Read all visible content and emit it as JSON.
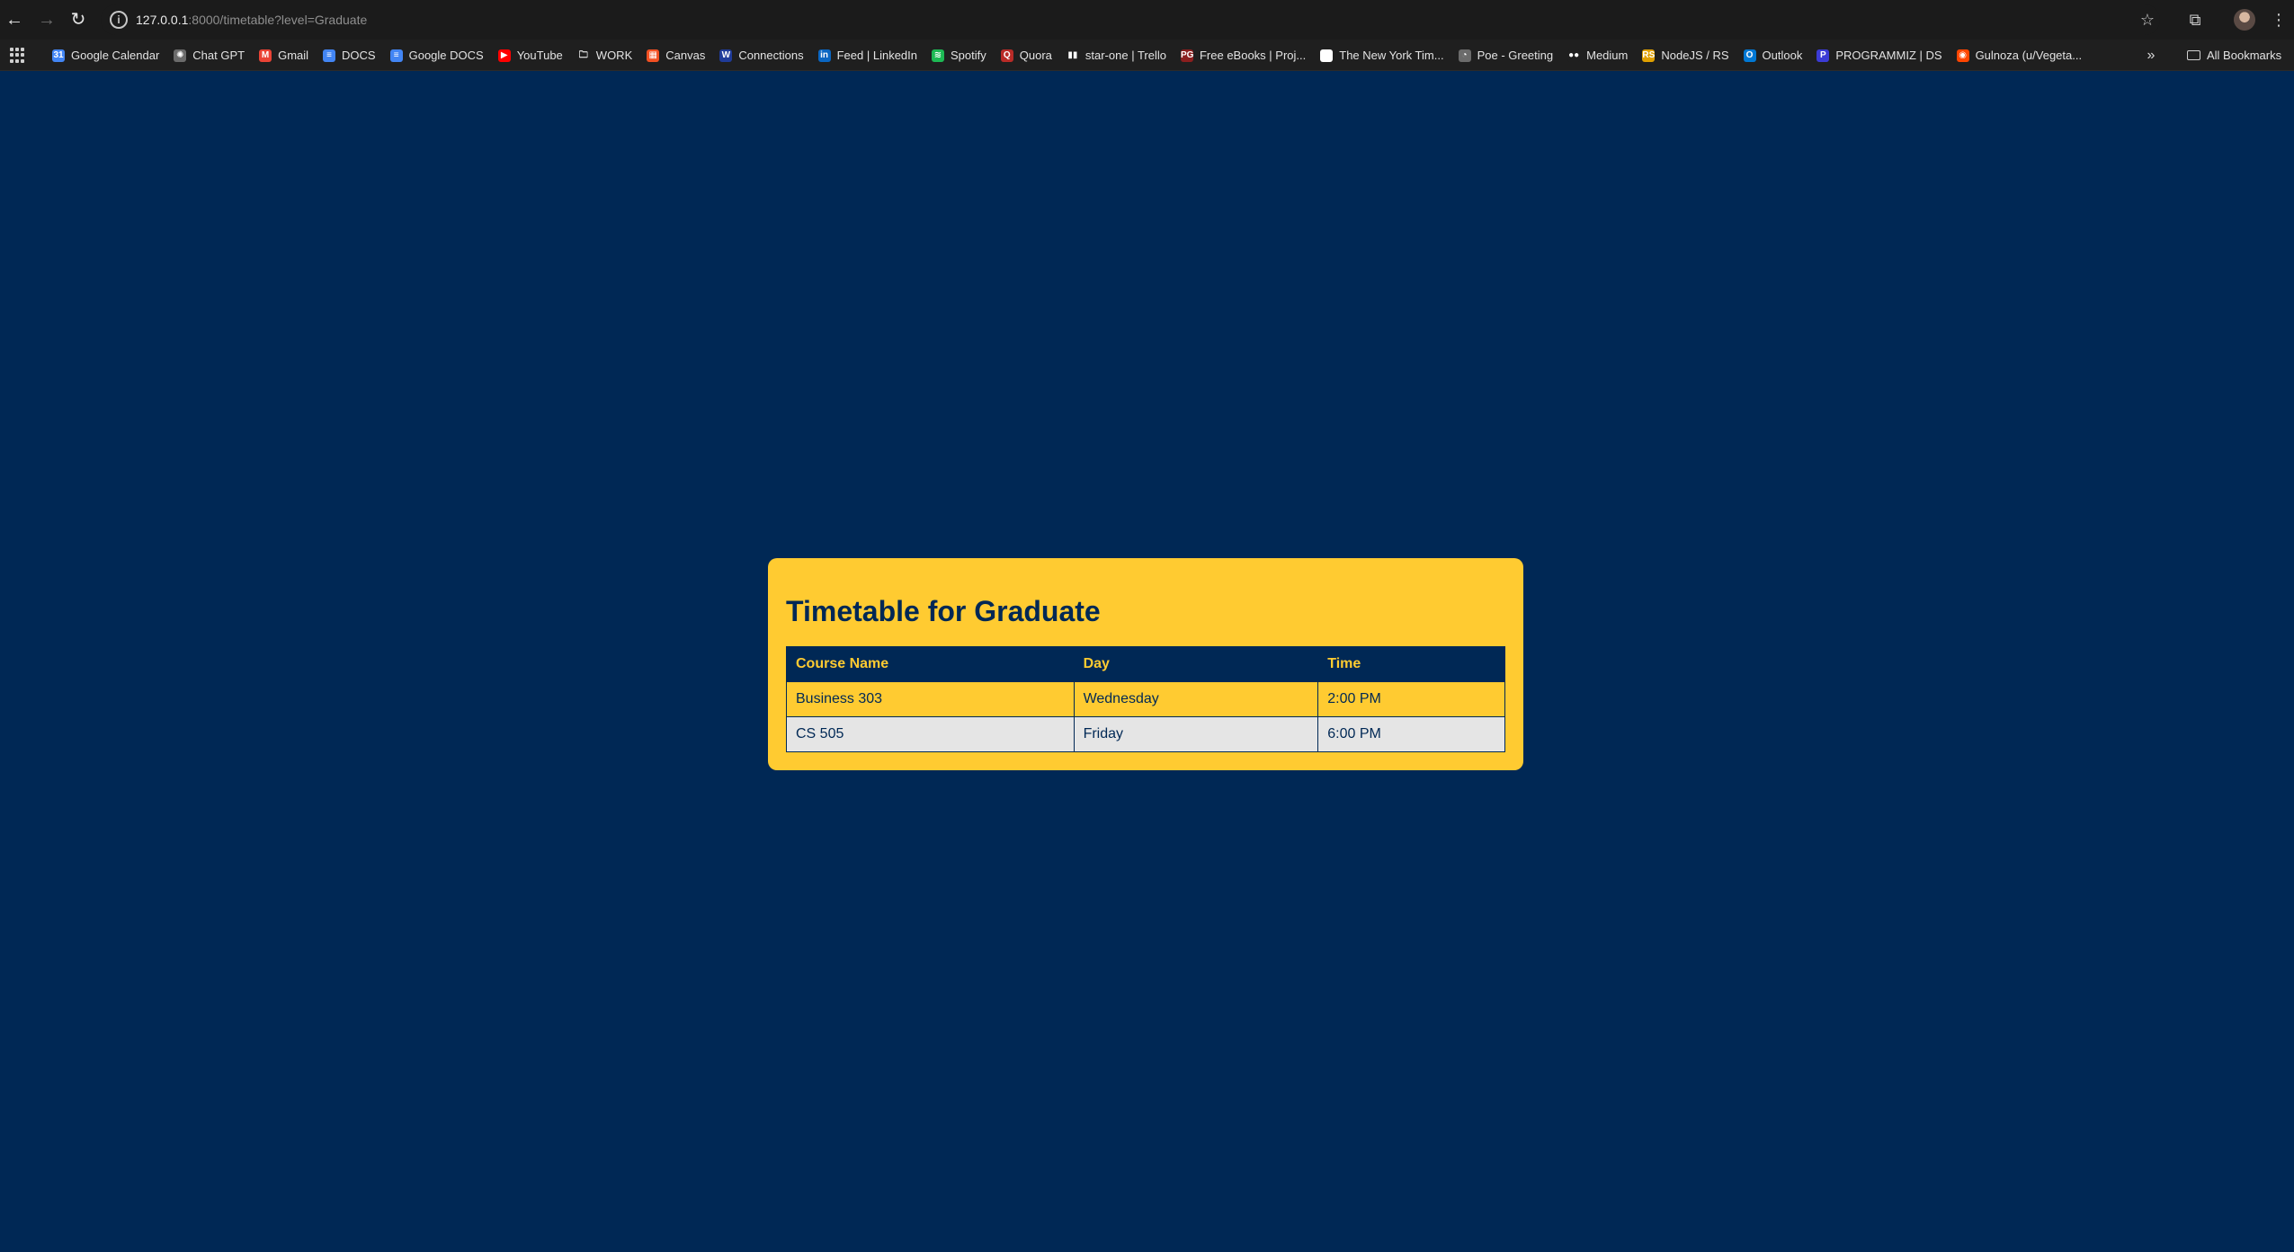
{
  "browser": {
    "url_host": "127.0.0.1",
    "url_path": ":8000/timetable?level=Graduate",
    "bookmarks": [
      {
        "label": "Google Calendar",
        "color": "#4285f4",
        "glyph": "31"
      },
      {
        "label": "Chat GPT",
        "color": "#6b6b6b",
        "glyph": "✺"
      },
      {
        "label": "Gmail",
        "color": "#ea4335",
        "glyph": "M"
      },
      {
        "label": "DOCS",
        "color": "#4285f4",
        "glyph": "≡"
      },
      {
        "label": "Google DOCS",
        "color": "#4285f4",
        "glyph": "≡"
      },
      {
        "label": "YouTube",
        "color": "#ff0000",
        "glyph": "▶"
      },
      {
        "label": "WORK",
        "color": "#1f1f1f",
        "glyph": "🗀"
      },
      {
        "label": "Canvas",
        "color": "#f25022",
        "glyph": "▦"
      },
      {
        "label": "Connections",
        "color": "#1f3b99",
        "glyph": "W"
      },
      {
        "label": "Feed | LinkedIn",
        "color": "#0a66c2",
        "glyph": "in"
      },
      {
        "label": "Spotify",
        "color": "#1db954",
        "glyph": "≋"
      },
      {
        "label": "Quora",
        "color": "#b92b27",
        "glyph": "Q"
      },
      {
        "label": "star-one | Trello",
        "color": "#1f1f1f",
        "glyph": "▮▮"
      },
      {
        "label": "Free eBooks | Proj...",
        "color": "#8b1e1e",
        "glyph": "PG"
      },
      {
        "label": "The New York Tim...",
        "color": "#ffffff",
        "glyph": "T"
      },
      {
        "label": "Poe - Greeting",
        "color": "#6b6b6b",
        "glyph": "◔"
      },
      {
        "label": "Medium",
        "color": "#1f1f1f",
        "glyph": "●●"
      },
      {
        "label": "NodeJS / RS",
        "color": "#e0a000",
        "glyph": "RS"
      },
      {
        "label": "Outlook",
        "color": "#0078d4",
        "glyph": "O"
      },
      {
        "label": "PROGRAMMIZ | DS",
        "color": "#3b3bd6",
        "glyph": "P"
      },
      {
        "label": "Gulnoza (u/Vegeta...",
        "color": "#ff4500",
        "glyph": "◉"
      }
    ],
    "all_bookmarks_label": "All Bookmarks"
  },
  "page": {
    "title": "Timetable for Graduate",
    "table": {
      "headers": [
        "Course Name",
        "Day",
        "Time"
      ],
      "rows": [
        [
          "Business 303",
          "Wednesday",
          "2:00 PM"
        ],
        [
          "CS 505",
          "Friday",
          "6:00 PM"
        ]
      ]
    }
  },
  "colors": {
    "background": "#002855",
    "card": "#ffcb31",
    "row_alt": "#e5e5e5"
  }
}
